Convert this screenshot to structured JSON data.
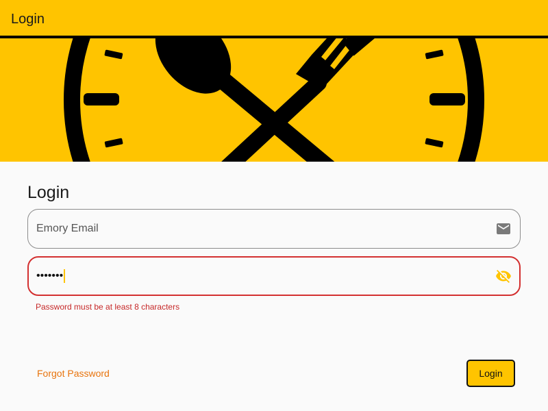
{
  "appbar": {
    "title": "Login"
  },
  "banner": {
    "icon": "clock-fork-spoon-icon"
  },
  "form": {
    "title": "Login",
    "email": {
      "placeholder": "Emory Email",
      "icon": "mail-icon"
    },
    "password": {
      "value": "•••••••",
      "icon": "visibility-off-icon",
      "error": "Password must be at least 8 characters"
    },
    "forgot_label": "Forgot Password",
    "login_label": "Login"
  },
  "colors": {
    "accent": "#ffc400",
    "error": "#d32f2f",
    "link": "#e8730c"
  }
}
